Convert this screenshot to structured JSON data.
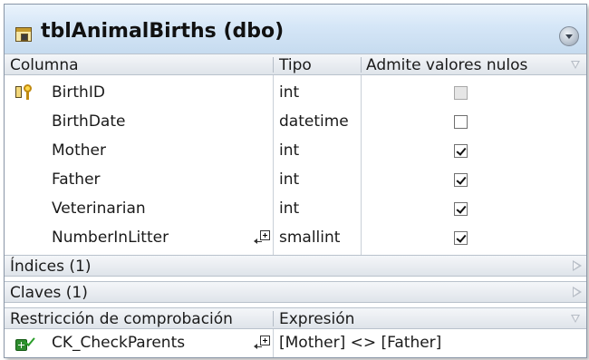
{
  "table": {
    "title": "tblAnimalBirths (dbo)",
    "icons": {
      "table": "table-icon",
      "collapse": "collapse-button-icon"
    }
  },
  "columns_header": {
    "name": "Columna",
    "type": "Tipo",
    "nullable": "Admite valores nulos"
  },
  "columns": [
    {
      "name": "BirthID",
      "type": "int",
      "nullable": false,
      "primary_key": true,
      "checkbox_state": "disabled"
    },
    {
      "name": "BirthDate",
      "type": "datetime",
      "nullable": false,
      "primary_key": false,
      "checkbox_state": "unchecked"
    },
    {
      "name": "Mother",
      "type": "int",
      "nullable": true,
      "primary_key": false,
      "checkbox_state": "checked"
    },
    {
      "name": "Father",
      "type": "int",
      "nullable": true,
      "primary_key": false,
      "checkbox_state": "checked"
    },
    {
      "name": "Veterinarian",
      "type": "int",
      "nullable": true,
      "primary_key": false,
      "checkbox_state": "checked"
    },
    {
      "name": "NumberInLitter",
      "type": "smallint",
      "nullable": true,
      "primary_key": false,
      "checkbox_state": "checked",
      "has_check_link": true
    }
  ],
  "sections": {
    "indexes": "Índices (1)",
    "keys": "Claves (1)"
  },
  "check_constraints": {
    "header_name": "Restricción de comprobación",
    "header_expression": "Expresión",
    "items": [
      {
        "name": "CK_CheckParents",
        "expression": "[Mother] <> [Father]"
      }
    ]
  },
  "colors": {
    "title_gradient_top": "#eaf3fc",
    "title_gradient_bottom": "#c6dbef",
    "header_bg": "#dfe4ea",
    "border": "#8a97a8"
  }
}
